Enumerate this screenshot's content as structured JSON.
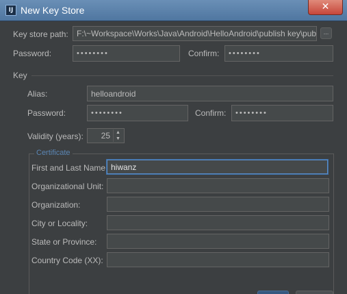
{
  "window": {
    "title": "New Key Store",
    "app_icon_text": "IJ",
    "close_symbol": "✕"
  },
  "keystore": {
    "path_label": "Key store path:",
    "path_value": "F:\\~Workspace\\Works\\Java\\Android\\HelloAndroid\\publish key\\pubkey",
    "browse_label": "...",
    "password_label": "Password:",
    "password_value": "••••••••",
    "confirm_label": "Confirm:",
    "confirm_value": "••••••••"
  },
  "key": {
    "section_label": "Key",
    "alias_label": "Alias:",
    "alias_value": "helloandroid",
    "password_label": "Password:",
    "password_value": "••••••••",
    "confirm_label": "Confirm:",
    "confirm_value": "••••••••",
    "validity_label": "Validity (years):",
    "validity_value": "25",
    "spin_up": "▲",
    "spin_down": "▼"
  },
  "certificate": {
    "legend": "Certificate",
    "first_last_label": "First and Last Name:",
    "first_last_value": "hiwanz",
    "org_unit_label": "Organizational Unit:",
    "org_unit_value": "",
    "organization_label": "Organization:",
    "organization_value": "",
    "city_label": "City or Locality:",
    "city_value": "",
    "state_label": "State or Province:",
    "state_value": "",
    "country_label": "Country Code (XX):",
    "country_value": ""
  },
  "colors": {
    "dialog_bg": "#3c3f41",
    "field_bg": "#45494a",
    "focus_border": "#5a8dc8",
    "legend_text": "#5b86b4",
    "primary_button": "#365880"
  }
}
